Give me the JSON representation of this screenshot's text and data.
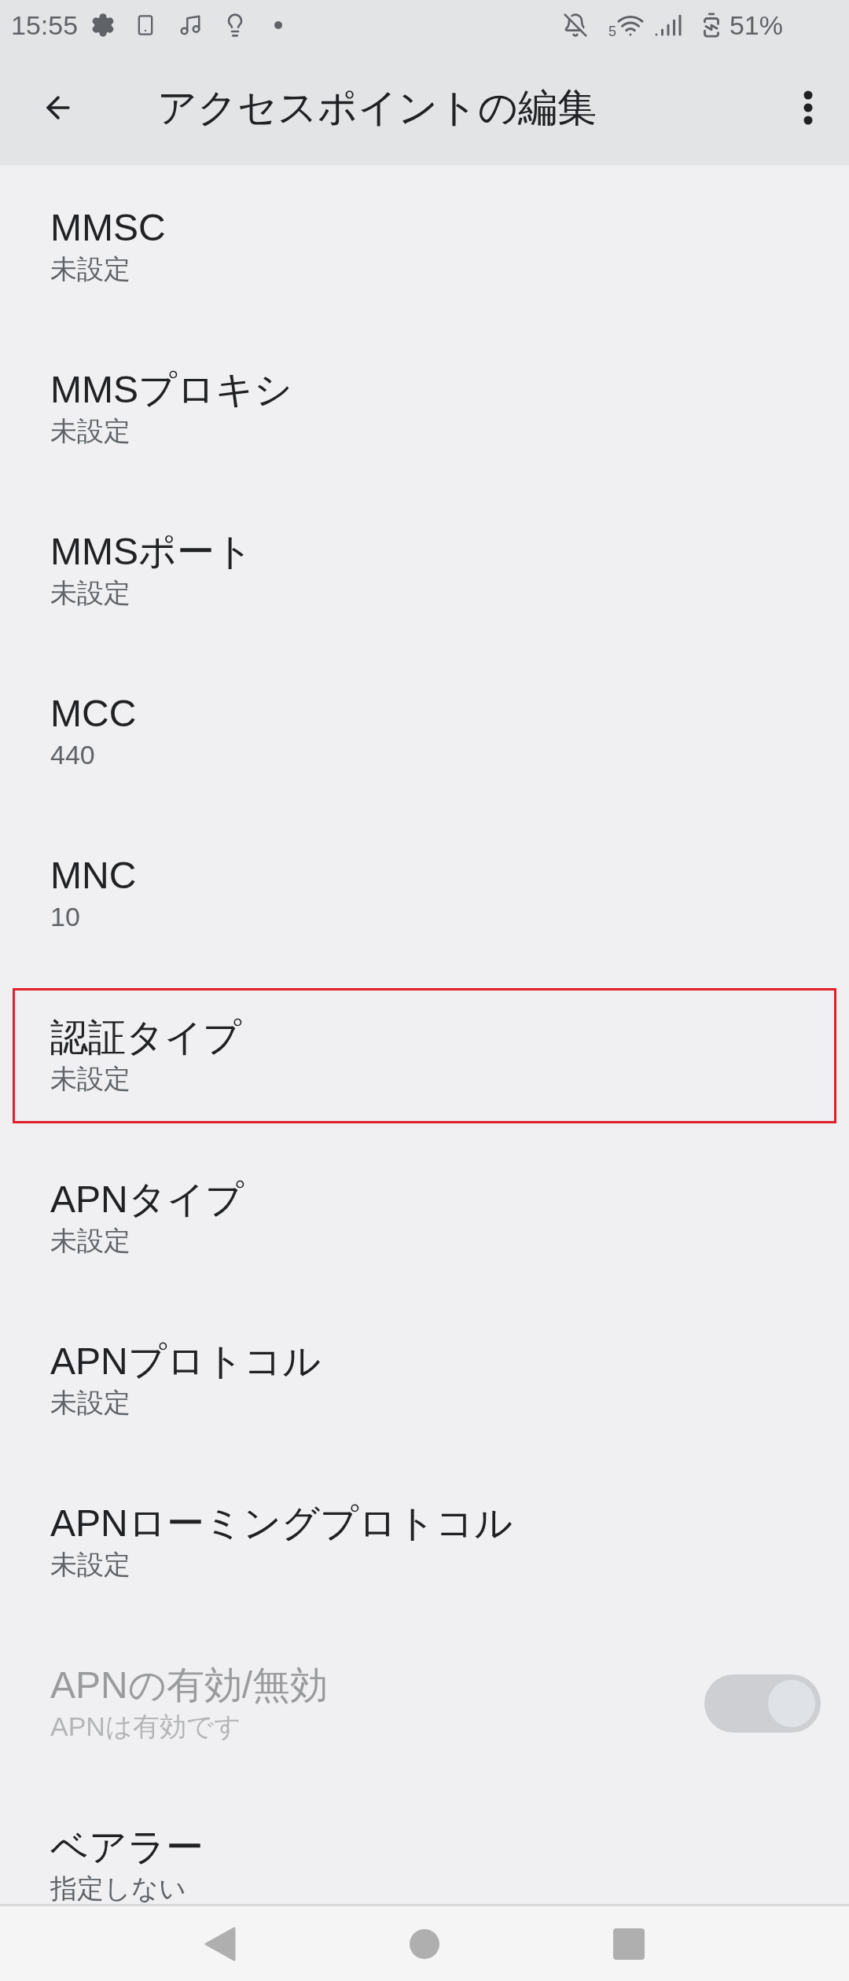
{
  "status_bar": {
    "time": "15:55",
    "wifi_band": "5",
    "battery": "51%"
  },
  "app_bar": {
    "title": "アクセスポイントの編集"
  },
  "settings": [
    {
      "kind": "text",
      "title": "MMSC",
      "summary": "未設定",
      "enabled": true,
      "highlighted": false
    },
    {
      "kind": "text",
      "title": "MMSプロキシ",
      "summary": "未設定",
      "enabled": true,
      "highlighted": false
    },
    {
      "kind": "text",
      "title": "MMSポート",
      "summary": "未設定",
      "enabled": true,
      "highlighted": false
    },
    {
      "kind": "text",
      "title": "MCC",
      "summary": "440",
      "enabled": true,
      "highlighted": false
    },
    {
      "kind": "text",
      "title": "MNC",
      "summary": "10",
      "enabled": true,
      "highlighted": false
    },
    {
      "kind": "text",
      "title": "認証タイプ",
      "summary": "未設定",
      "enabled": true,
      "highlighted": true
    },
    {
      "kind": "text",
      "title": "APNタイプ",
      "summary": "未設定",
      "enabled": true,
      "highlighted": false
    },
    {
      "kind": "text",
      "title": "APNプロトコル",
      "summary": "未設定",
      "enabled": true,
      "highlighted": false
    },
    {
      "kind": "text",
      "title": "APNローミングプロトコル",
      "summary": "未設定",
      "enabled": true,
      "highlighted": false
    },
    {
      "kind": "switch",
      "title": "APNの有効/無効",
      "summary": "APNは有効です",
      "enabled": false,
      "on": true,
      "highlighted": false
    },
    {
      "kind": "text",
      "title": "ベアラー",
      "summary": "指定しない",
      "enabled": true,
      "highlighted": false
    }
  ]
}
